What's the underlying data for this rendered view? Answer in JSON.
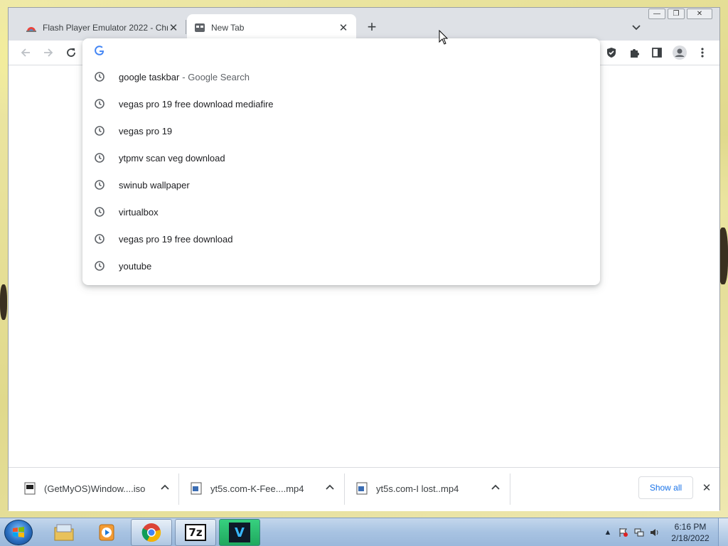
{
  "browser": {
    "tabs": [
      {
        "title": "Flash Player Emulator 2022 - Chr",
        "active": false
      },
      {
        "title": "New Tab",
        "active": true
      }
    ],
    "window_controls": {
      "minimize": "—",
      "restore": "❐",
      "close": "✕"
    }
  },
  "omnibox": {
    "input_value": "",
    "suggestions": [
      {
        "text": "google taskbar",
        "secondary": "- Google Search"
      },
      {
        "text": "vegas pro 19 free download mediafire",
        "secondary": ""
      },
      {
        "text": "vegas pro 19",
        "secondary": ""
      },
      {
        "text": "ytpmv scan veg download",
        "secondary": ""
      },
      {
        "text": "swinub wallpaper",
        "secondary": ""
      },
      {
        "text": "virtualbox",
        "secondary": ""
      },
      {
        "text": "vegas pro 19 free download",
        "secondary": ""
      },
      {
        "text": "youtube",
        "secondary": ""
      }
    ]
  },
  "downloads": {
    "items": [
      {
        "name": "(GetMyOS)Window....iso"
      },
      {
        "name": "yt5s.com-K-Fee....mp4"
      },
      {
        "name": "yt5s.com-I lost..mp4"
      }
    ],
    "show_all_label": "Show all"
  },
  "taskbar": {
    "apps": [
      "windows-explorer",
      "media-player",
      "chrome",
      "7-zip",
      "vegas"
    ],
    "seven_zip_label": "7z",
    "vegas_label": "V",
    "time": "6:16 PM",
    "date": "2/18/2022"
  },
  "colors": {
    "accent": "#1a73e8",
    "tabstrip": "#dee1e6",
    "taskbar": "#a8c3e2"
  }
}
